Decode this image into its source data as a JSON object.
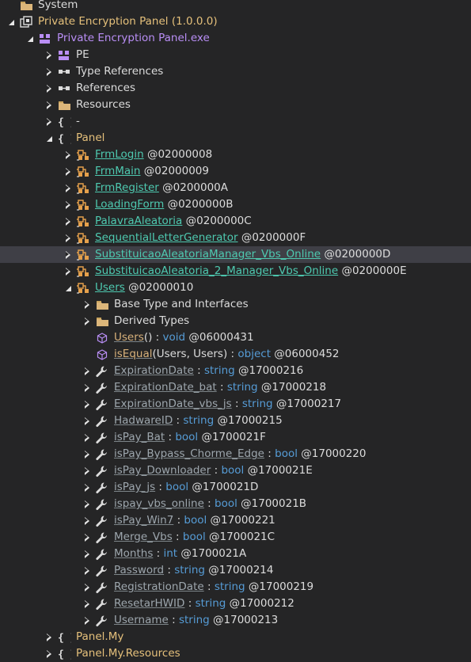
{
  "colors": {
    "background": "#252526",
    "selected_row": "#3f3f46",
    "namespace": "#e5c07b",
    "type": "#4ec9b0",
    "keyword": "#569cd6",
    "property": "#9da6ad",
    "method": "#d7b07a",
    "module": "#b98ef5"
  },
  "tree": {
    "top_partial": "System",
    "assembly": {
      "name": "Private Encryption Panel",
      "version": "(1.0.0.0)"
    },
    "module": {
      "name": "Private Encryption Panel.exe"
    },
    "module_children": [
      {
        "label": "PE",
        "icon": "pe-icon"
      },
      {
        "label": "Type References",
        "icon": "references-icon"
      },
      {
        "label": "References",
        "icon": "references-icon"
      },
      {
        "label": "Resources",
        "icon": "folder-icon"
      },
      {
        "label": "-",
        "icon": "namespace-icon"
      }
    ],
    "panel_namespace": "Panel",
    "classes": [
      {
        "name": "FrmLogin",
        "token": "@02000008"
      },
      {
        "name": "FrmMain",
        "token": "@02000009"
      },
      {
        "name": "FrmRegister",
        "token": "@0200000A"
      },
      {
        "name": "LoadingForm",
        "token": "@0200000B"
      },
      {
        "name": "PalavraAleatoria",
        "token": "@0200000C"
      },
      {
        "name": "SequentialLetterGenerator",
        "token": "@0200000F"
      },
      {
        "name": "SubstituicaoAleatoriaManager_Vbs_Online",
        "token": "@0200000D"
      },
      {
        "name": "SubstituicaoAleatoria_2_Manager_Vbs_Online",
        "token": "@0200000E"
      }
    ],
    "users_class": {
      "name": "Users",
      "token": "@02000010"
    },
    "users_folders": [
      {
        "label": "Base Type and Interfaces"
      },
      {
        "label": "Derived Types"
      }
    ],
    "methods": [
      {
        "name": "Users",
        "open": "(",
        "params": [],
        "close": ")",
        "sep": " : ",
        "ret": "void",
        "token": "@06000431"
      },
      {
        "name": "isEqual",
        "open": "(",
        "params": [
          "Users",
          "Users"
        ],
        "close": ")",
        "sep": " : ",
        "ret": "object",
        "token": "@06000452"
      }
    ],
    "properties": [
      {
        "name": "ExpirationDate",
        "type": "string",
        "token": "@17000216"
      },
      {
        "name": "ExpirationDate_bat",
        "type": "string",
        "token": "@17000218"
      },
      {
        "name": "ExpirationDate_vbs_js",
        "type": "string",
        "token": "@17000217"
      },
      {
        "name": "HadwareID",
        "type": "string",
        "token": "@17000215"
      },
      {
        "name": "isPay_Bat",
        "type": "bool",
        "token": "@1700021F"
      },
      {
        "name": "isPay_Bypass_Chorme_Edge",
        "type": "bool",
        "token": "@17000220"
      },
      {
        "name": "isPay_Downloader",
        "type": "bool",
        "token": "@1700021E"
      },
      {
        "name": "isPay_js",
        "type": "bool",
        "token": "@1700021D"
      },
      {
        "name": "ispay_vbs_online",
        "type": "bool",
        "token": "@1700021B"
      },
      {
        "name": "isPay_Win7",
        "type": "bool",
        "token": "@17000221"
      },
      {
        "name": "Merge_Vbs",
        "type": "bool",
        "token": "@1700021C"
      },
      {
        "name": "Months",
        "type": "int",
        "token": "@1700021A"
      },
      {
        "name": "Password",
        "type": "string",
        "token": "@17000214"
      },
      {
        "name": "RegistrationDate",
        "type": "string",
        "token": "@17000219"
      },
      {
        "name": "ResetarHWID",
        "type": "string",
        "token": "@17000212"
      },
      {
        "name": "Username",
        "type": "string",
        "token": "@17000213"
      }
    ],
    "trailing_namespaces": [
      "Panel.My",
      "Panel.My.Resources"
    ],
    "selected_class_index": 6
  }
}
